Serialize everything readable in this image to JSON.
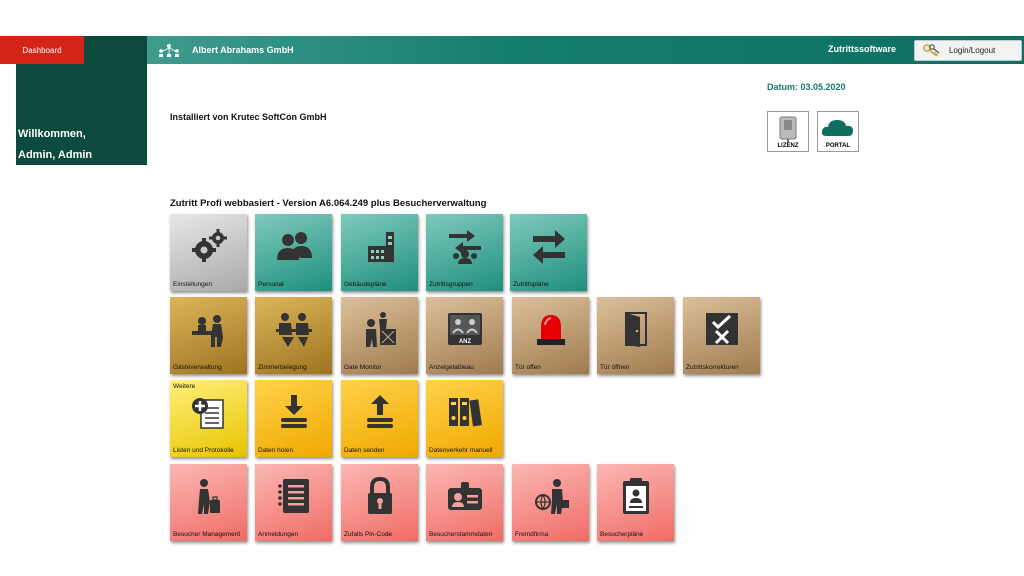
{
  "header": {
    "dashboard_label": "Dashboard",
    "company": "Albert Abrahams GmbH",
    "software": "Zutrittssoftware",
    "login_label": "Login/Logout"
  },
  "welcome": {
    "line1": "Willkommen,",
    "line2": "Admin, Admin"
  },
  "installed_by": "Installiert von Krutec SoftCon GmbH",
  "datum": "Datum:  03.05.2020",
  "badges": {
    "lizenz": "LIZENZ",
    "portal": "PORTAL"
  },
  "version_title": "Zutritt Profi webbasiert - Version A6.064.249 plus Besucherverwaltung",
  "tiles": {
    "einstellungen": "Einstellungen",
    "personal": "Personal",
    "gebaeudeplaene": "Gebäudepläne",
    "zutrittsgruppen": "Zutrittsgruppen",
    "zutrittsplaene": "Zutrittspläne",
    "gaesteverwaltung": "Gästeverwaltung",
    "zimmerbelegung": "Zimmerbelegung",
    "gate_monitor": "Gate Monitor",
    "anzeigetableau": "Anzeigetableau",
    "tuer_offen": "Tür offen",
    "tuer_oeffnen": "Tür öffnen",
    "zutrittskorrekturen": "Zutrittskorrekturen",
    "weitere_top": "Weitere",
    "listen_protokolle": "Listen und Protokolle",
    "daten_holen": "Daten holen",
    "daten_senden": "Daten senden",
    "datenverkehr": "Datenverkehr manuell",
    "besucher_management": "Besucher  Management",
    "anmeldungen": "Anmeldungen",
    "zufalls_pin": "Zufalls Pin-Code",
    "besucherstammdaten": "Besucherstammdaten",
    "fremdfirma": "Fremdfirma",
    "besucherplaene": "Besucherpläne"
  },
  "icon_text": {
    "anz": "ANZ"
  },
  "colors": {
    "header_teal": "#157d6d",
    "dashboard_red": "#d42418",
    "welcome_green": "#0b4a3c",
    "datum_green": "#137a68"
  }
}
